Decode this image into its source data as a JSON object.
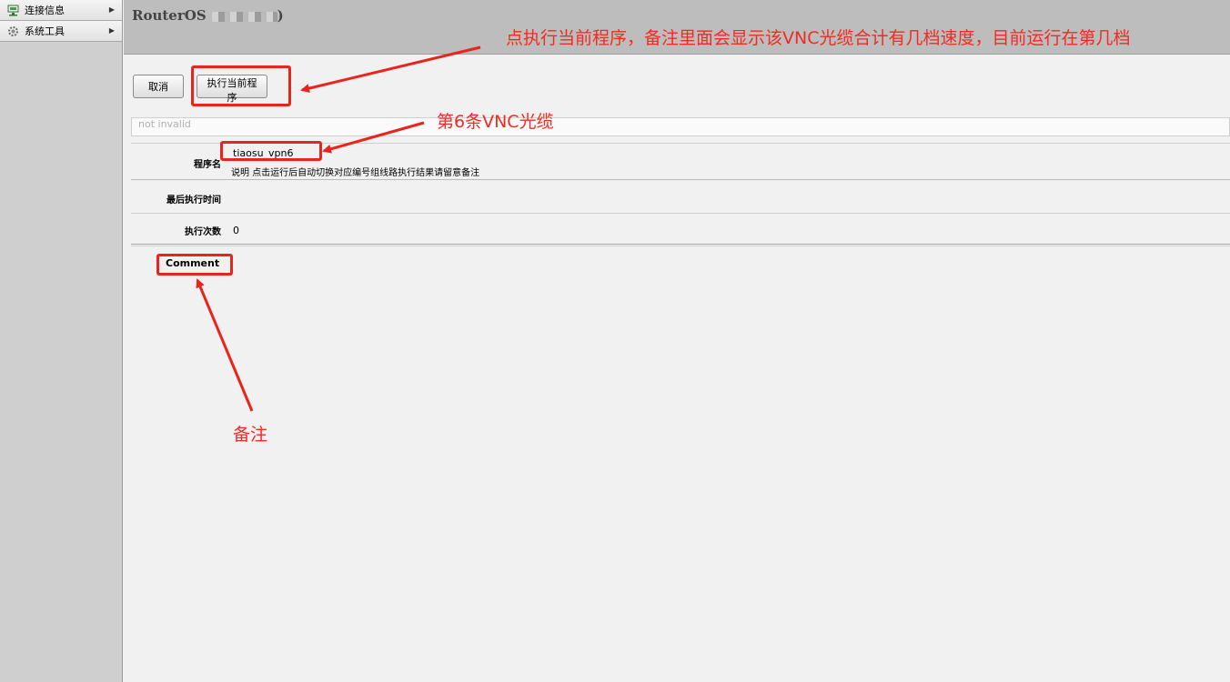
{
  "sidebar": {
    "items": [
      {
        "label": "连接信息",
        "icon": "network-icon"
      },
      {
        "label": "系统工具",
        "icon": "gear-icon"
      }
    ]
  },
  "header": {
    "title": "RouterOS",
    "title_suffix": ")"
  },
  "toolbar": {
    "cancel_label": "取消",
    "run_label": "执行当前程序"
  },
  "status": {
    "value": "not invalid"
  },
  "form": {
    "name_label": "程序名",
    "name_value": "tiaosu_vpn6",
    "description": "说明 点击运行后自动切换对应编号组线路执行结果请留意备注",
    "last_run_label": "最后执行时间",
    "last_run_value": "",
    "run_count_label": "执行次数",
    "run_count_value": "0",
    "comment_label": "Comment"
  },
  "annotations": {
    "run_note": "点执行当前程序，备注里面会显示该VNC光缆合计有几档速度，目前运行在第几档",
    "cable_note": "第6条VNC光缆",
    "comment_note": "备注",
    "color": "#e8241c"
  }
}
